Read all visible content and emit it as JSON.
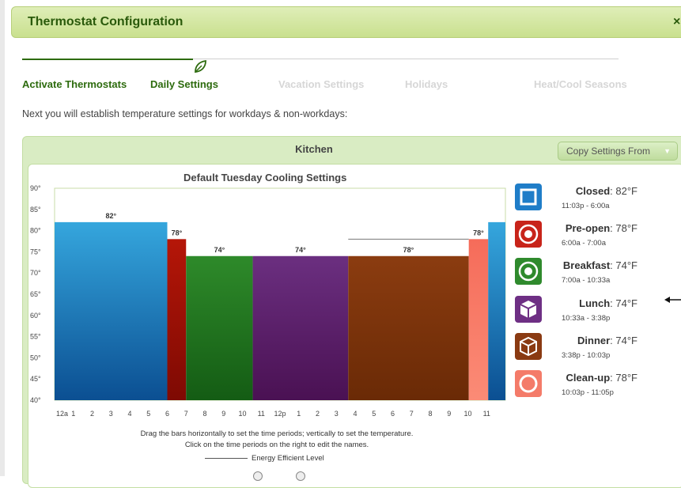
{
  "dialog": {
    "title": "Thermostat Configuration",
    "close": "×"
  },
  "steps": [
    {
      "label": "Activate Thermostats",
      "state": "active"
    },
    {
      "label": "Daily Settings",
      "state": "active"
    },
    {
      "label": "Vacation Settings",
      "state": "inactive"
    },
    {
      "label": "Holidays",
      "state": "inactive"
    },
    {
      "label": "Heat/Cool Seasons",
      "state": "inactive"
    }
  ],
  "intro": "Next you will establish temperature settings for workdays & non-workdays:",
  "zone": {
    "name": "Kitchen",
    "copy_button": "Copy Settings From"
  },
  "chart_data": {
    "type": "bar",
    "title": "Default Tuesday Cooling Settings",
    "y_ticks": [
      "90°",
      "85°",
      "80°",
      "75°",
      "70°",
      "65°",
      "60°",
      "55°",
      "50°",
      "45°",
      "40°"
    ],
    "ylim": [
      40,
      90
    ],
    "x_ticks": [
      "12a",
      "1",
      "2",
      "3",
      "4",
      "5",
      "6",
      "7",
      "8",
      "9",
      "10",
      "11",
      "12p",
      "1",
      "2",
      "3",
      "4",
      "5",
      "6",
      "7",
      "8",
      "9",
      "10",
      "11"
    ],
    "xlim_hours": [
      0,
      24
    ],
    "energy_efficient_level": 78,
    "bars": [
      {
        "period": "Closed",
        "start": 0,
        "end": 6.0,
        "value": 82,
        "label": "82°",
        "color_top": "#35a6dd",
        "color_bottom": "#0b4f92"
      },
      {
        "period": "Pre-open",
        "start": 6.0,
        "end": 7.0,
        "value": 78,
        "label": "78°",
        "color_top": "#b51608",
        "color_bottom": "#7e0a03"
      },
      {
        "period": "Breakfast",
        "start": 7.0,
        "end": 10.55,
        "value": 74,
        "label": "74°",
        "color_top": "#2e8a2a",
        "color_bottom": "#145c14"
      },
      {
        "period": "Lunch",
        "start": 10.55,
        "end": 15.633,
        "value": 74,
        "label": "74°",
        "color_top": "#6b2f80",
        "color_bottom": "#4a1153"
      },
      {
        "period": "Dinner",
        "start": 15.633,
        "end": 22.05,
        "value": 74,
        "label": "78°",
        "color_top": "#8b3c10",
        "color_bottom": "#6a2a06"
      },
      {
        "period": "Clean-up",
        "start": 22.05,
        "end": 23.083,
        "value": 78,
        "label": "78°",
        "color_top": "#f56c5a",
        "color_bottom": "#fb8b76"
      },
      {
        "period": "Closed",
        "start": 23.083,
        "end": 24,
        "value": 82,
        "label": "",
        "color_top": "#35a6dd",
        "color_bottom": "#0b4f92"
      }
    ]
  },
  "instructions": {
    "line1": "Drag the bars horizontally to set the time periods; vertically to set the temperature.",
    "line2": "Click on the time periods on the right to edit the names.",
    "legend": "Energy Efficient Level"
  },
  "periods": [
    {
      "name": "Closed",
      "temp": ": 82°F",
      "time": "11:03p - 6:00a",
      "icon": "square-icon",
      "color": "#1f7dc8"
    },
    {
      "name": "Pre-open",
      "temp": ": 78°F",
      "time": "6:00a - 7:00a",
      "icon": "target-icon",
      "color": "#c8241a"
    },
    {
      "name": "Breakfast",
      "temp": ": 74°F",
      "time": "7:00a - 10:33a",
      "icon": "target-icon",
      "color": "#2f8a2d"
    },
    {
      "name": "Lunch",
      "temp": ": 74°F",
      "time": "10:33a - 3:38p",
      "icon": "cube-icon",
      "color": "#6e2f84"
    },
    {
      "name": "Dinner",
      "temp": ": 74°F",
      "time": "3:38p - 10:03p",
      "icon": "cube-outline-icon",
      "color": "#8a3a12"
    },
    {
      "name": "Clean-up",
      "temp": ": 78°F",
      "time": "10:03p - 11:05p",
      "icon": "circle-icon",
      "color": "#f47b69"
    }
  ]
}
